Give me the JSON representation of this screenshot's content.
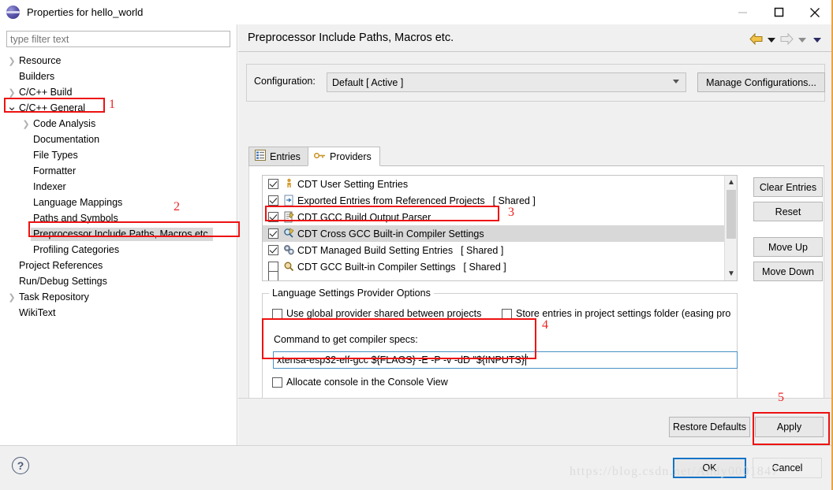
{
  "window": {
    "title": "Properties for hello_world",
    "icon": "eclipse-globe-icon",
    "minimize_label": "—",
    "maximize_label": "☐",
    "close_label": "✕"
  },
  "sidebar": {
    "filter_placeholder": "type filter text",
    "filter_value": "",
    "items": [
      {
        "label": "Resource",
        "level": 0,
        "arrow": "collapsed",
        "selected": false
      },
      {
        "label": "Builders",
        "level": 0,
        "arrow": "none",
        "selected": false
      },
      {
        "label": "C/C++ Build",
        "level": 0,
        "arrow": "collapsed",
        "selected": false
      },
      {
        "label": "C/C++ General",
        "level": 0,
        "arrow": "expanded",
        "selected": false
      },
      {
        "label": "Code Analysis",
        "level": 1,
        "arrow": "collapsed",
        "selected": false
      },
      {
        "label": "Documentation",
        "level": 1,
        "arrow": "none",
        "selected": false
      },
      {
        "label": "File Types",
        "level": 1,
        "arrow": "none",
        "selected": false
      },
      {
        "label": "Formatter",
        "level": 1,
        "arrow": "none",
        "selected": false
      },
      {
        "label": "Indexer",
        "level": 1,
        "arrow": "none",
        "selected": false
      },
      {
        "label": "Language Mappings",
        "level": 1,
        "arrow": "none",
        "selected": false
      },
      {
        "label": "Paths and Symbols",
        "level": 1,
        "arrow": "none",
        "selected": false
      },
      {
        "label": "Preprocessor Include Paths, Macros etc.",
        "level": 1,
        "arrow": "none",
        "selected": true
      },
      {
        "label": "Profiling Categories",
        "level": 1,
        "arrow": "none",
        "selected": false
      },
      {
        "label": "Project References",
        "level": 0,
        "arrow": "none",
        "selected": false
      },
      {
        "label": "Run/Debug Settings",
        "level": 0,
        "arrow": "none",
        "selected": false
      },
      {
        "label": "Task Repository",
        "level": 0,
        "arrow": "collapsed",
        "selected": false
      },
      {
        "label": "WikiText",
        "level": 0,
        "arrow": "none",
        "selected": false
      }
    ]
  },
  "main": {
    "page_title": "Preprocessor Include Paths, Macros etc.",
    "nav": {
      "back_icon": "back-arrow-icon",
      "back_menu_icon": "chevron-down-icon",
      "forward_icon": "forward-arrow-icon",
      "forward_menu_icon": "chevron-down-icon",
      "view_menu_icon": "chevron-down-icon"
    },
    "configuration": {
      "label": "Configuration:",
      "value": "Default  [ Active ]",
      "manage_button": "Manage Configurations..."
    },
    "tabs": [
      {
        "label": "Entries",
        "icon": "entries-table-icon",
        "active": false
      },
      {
        "label": "Providers",
        "icon": "key-icon",
        "active": true
      }
    ],
    "providers": [
      {
        "label": "CDT User Setting Entries",
        "shared": "",
        "checked": true,
        "icon": "person-icon",
        "selected": false
      },
      {
        "label": "Exported Entries from Referenced Projects",
        "shared": "[ Shared ]",
        "checked": true,
        "icon": "export-doc-icon",
        "selected": false
      },
      {
        "label": "CDT GCC Build Output Parser",
        "shared": "",
        "checked": true,
        "icon": "parser-doc-icon",
        "selected": false
      },
      {
        "label": "CDT Cross GCC Built-in Compiler Settings",
        "shared": "",
        "checked": true,
        "icon": "magnifier-pen-icon",
        "selected": true
      },
      {
        "label": "CDT Managed Build Setting Entries",
        "shared": "[ Shared ]",
        "checked": true,
        "icon": "gears-icon",
        "selected": false
      },
      {
        "label": "CDT GCC Built-in Compiler Settings",
        "shared": "[ Shared ]",
        "checked": false,
        "icon": "magnifier-icon",
        "selected": false
      }
    ],
    "side_buttons": [
      {
        "label": "Clear Entries"
      },
      {
        "label": "Reset"
      },
      {
        "label": "Move Up"
      },
      {
        "label": "Move Down"
      }
    ],
    "options_group": {
      "legend": "Language Settings Provider Options",
      "checkbox_global": {
        "label": "Use global provider shared between projects",
        "checked": false
      },
      "checkbox_store": {
        "label": "Store entries in project settings folder (easing pro",
        "checked": false
      },
      "command_label": "Command to get compiler specs:",
      "command_value": "xtensa-esp32-elf-gcc ${FLAGS} -E -P -v -dD \"${INPUTS}\"",
      "checkbox_console": {
        "label": "Allocate console in the Console View",
        "checked": false
      }
    },
    "bottom_buttons": {
      "restore_defaults": "Restore Defaults",
      "apply": "Apply"
    }
  },
  "footer": {
    "help_icon": "help-question-icon",
    "ok": "OK",
    "cancel": "Cancel",
    "watermark": "https://blog.csdn.net/Andy0001847"
  },
  "annotations": [
    {
      "number": "1"
    },
    {
      "number": "2"
    },
    {
      "number": "3"
    },
    {
      "number": "4"
    },
    {
      "number": "5"
    }
  ],
  "colors": {
    "annotation_red": "#ee1111",
    "focus_blue": "#1573c6",
    "selection_gray": "#d8d8d8"
  }
}
